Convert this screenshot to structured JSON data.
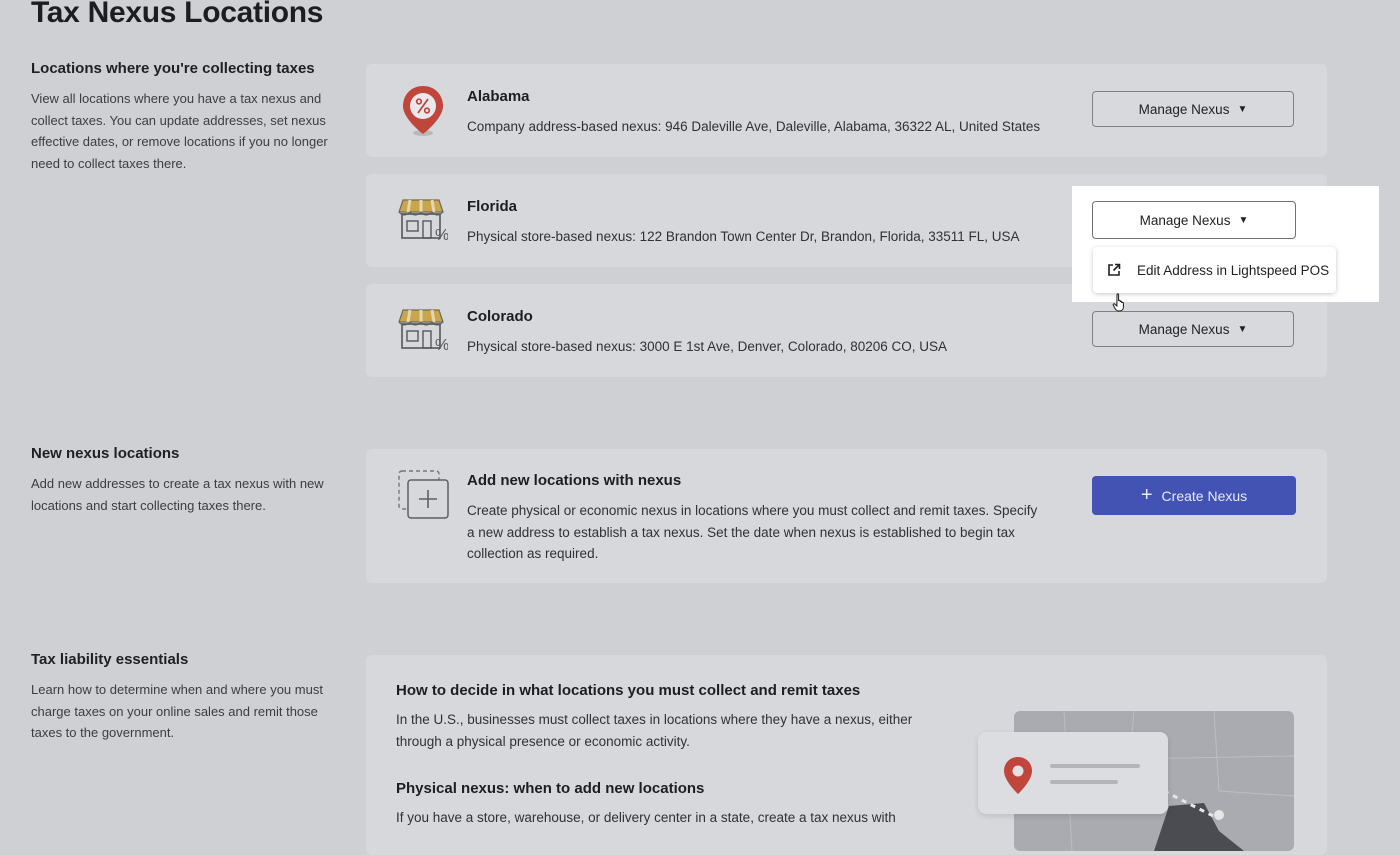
{
  "page": {
    "title": "Tax Nexus Locations"
  },
  "collecting": {
    "title": "Locations where you're collecting taxes",
    "description": "View all locations where you have a tax nexus and collect taxes. You can update addresses, set nexus effective dates, or remove locations if you no longer need to collect taxes there.",
    "locations": [
      {
        "name": "Alabama",
        "detail": "Company address-based nexus: 946 Daleville Ave, Daleville, Alabama, 36322 AL, United States",
        "icon": "map-pin-percent-icon",
        "button": "Manage Nexus"
      },
      {
        "name": "Florida",
        "detail": "Physical store-based nexus: 122 Brandon Town Center Dr, Brandon, Florida, 33511 FL, USA",
        "icon": "store-percent-icon",
        "button": "Manage Nexus"
      },
      {
        "name": "Colorado",
        "detail": "Physical store-based nexus: 3000 E 1st Ave, Denver, Colorado, 80206 CO, USA",
        "icon": "store-percent-icon",
        "button": "Manage Nexus"
      }
    ],
    "dropdown": {
      "item": "Edit Address in Lightspeed POS",
      "icon": "external-link-icon"
    }
  },
  "new_nexus": {
    "title": "New nexus locations",
    "description": "Add new addresses to create a tax nexus with new locations and start collecting taxes there.",
    "card_title": "Add new locations with nexus",
    "card_description": "Create physical or economic nexus in locations where you must collect and remit taxes. Specify a new address to establish a tax nexus. Set the date when nexus is established to begin tax collection as required.",
    "button": "Create Nexus"
  },
  "essentials": {
    "title": "Tax liability essentials",
    "description": "Learn how to determine when and where you must charge taxes on your online sales and remit those taxes to the government.",
    "heading1": "How to decide in what locations you must collect and remit taxes",
    "para1": "In the U.S., businesses must collect taxes in locations where they have a nexus, either through a physical presence or economic activity.",
    "heading2": "Physical nexus: when to add new locations",
    "para2": "If you have a store, warehouse, or delivery center in a state, create a tax nexus with"
  },
  "colors": {
    "primary": "#4353b4",
    "pin": "#c0453a",
    "awning": "#c9a54c"
  }
}
